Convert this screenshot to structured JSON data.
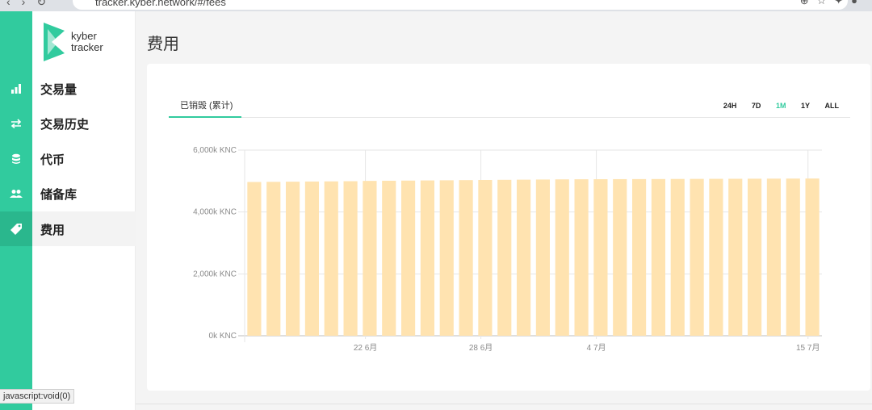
{
  "browser": {
    "url": "tracker.kyber.network/#/fees"
  },
  "brand": {
    "name_line1": "kyber",
    "name_line2": "tracker"
  },
  "sidebar": {
    "items": [
      {
        "label": "交易量",
        "icon": "bar-chart-icon"
      },
      {
        "label": "交易历史",
        "icon": "swap-arrows-icon"
      },
      {
        "label": "代币",
        "icon": "coin-stack-icon"
      },
      {
        "label": "储备库",
        "icon": "users-icon"
      },
      {
        "label": "费用",
        "icon": "tag-icon",
        "active": true
      }
    ]
  },
  "page": {
    "title": "费用"
  },
  "tabs": {
    "active_label": "已销毁 (累计)"
  },
  "ranges": [
    "24H",
    "7D",
    "1M",
    "1Y",
    "ALL"
  ],
  "selected_range": "1M",
  "status_bar": "javascript:void(0)",
  "colors": {
    "accent": "#31cb9e",
    "bar": "#ffe3b0"
  },
  "chart_data": {
    "type": "bar",
    "ylim": [
      0,
      6000
    ],
    "yticks": [
      "0k KNC",
      "2,000k KNC",
      "4,000k KNC",
      "6,000k KNC"
    ],
    "xticks": [
      {
        "label": "22 6月",
        "bar_index": 6
      },
      {
        "label": "28 6月",
        "bar_index": 12
      },
      {
        "label": "4 7月",
        "bar_index": 18
      },
      {
        "label": "15 7月",
        "bar_index": 29
      }
    ],
    "values": [
      4970,
      4975,
      4980,
      4985,
      4990,
      4995,
      5005,
      5010,
      5015,
      5020,
      5025,
      5030,
      5035,
      5040,
      5045,
      5050,
      5055,
      5058,
      5060,
      5062,
      5064,
      5066,
      5068,
      5070,
      5072,
      5074,
      5076,
      5078,
      5080,
      5082
    ]
  }
}
